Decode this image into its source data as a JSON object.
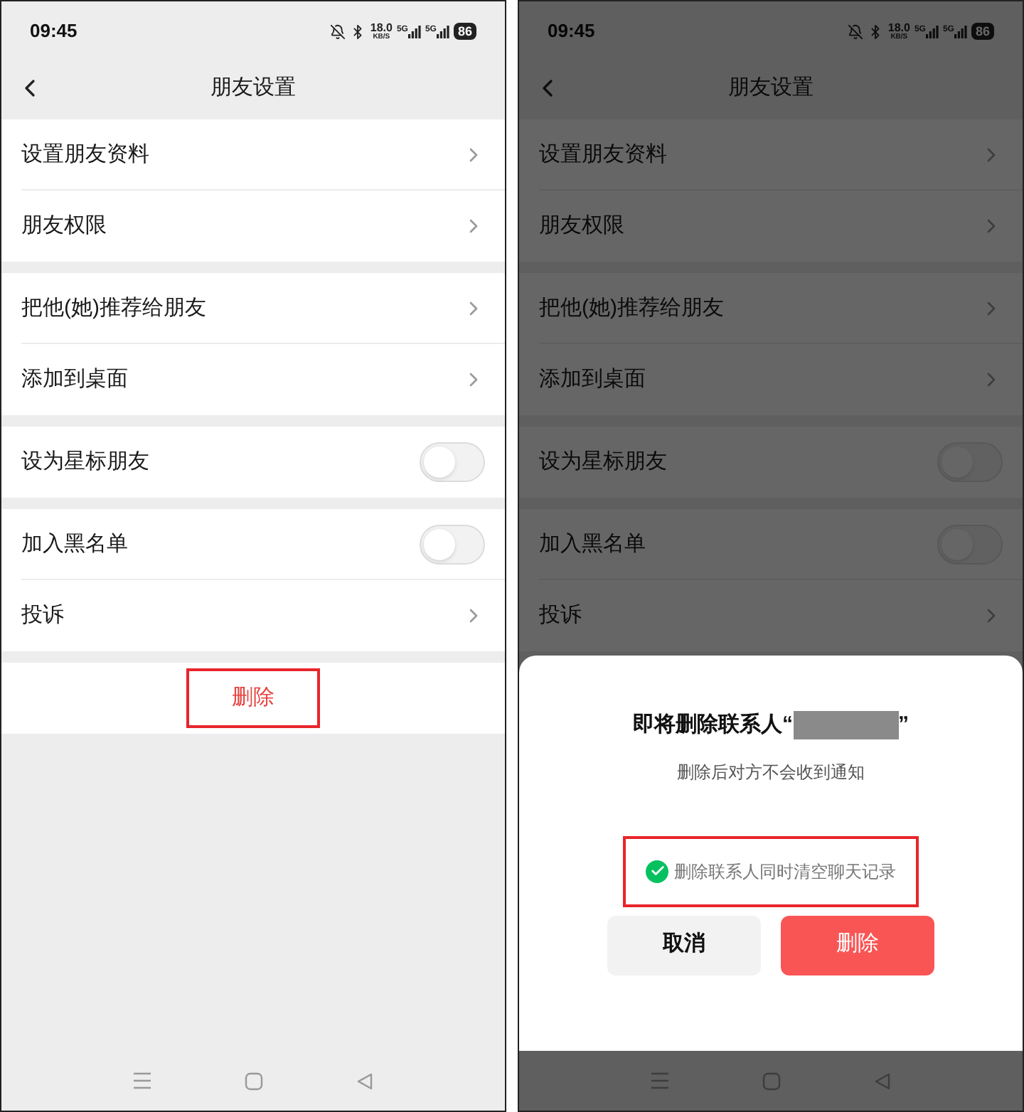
{
  "screens": [
    {
      "status_bar": {
        "time": "09:45",
        "speed": "18.0",
        "speed_unit": "KB/S",
        "networks": [
          "5G",
          "5G"
        ],
        "battery": "86"
      },
      "header": {
        "title": "朋友设置"
      },
      "dimmed": false,
      "groups": [
        {
          "rows": [
            {
              "kind": "link",
              "label": "设置朋友资料"
            },
            {
              "kind": "link",
              "label": "朋友权限"
            }
          ]
        },
        {
          "rows": [
            {
              "kind": "link",
              "label": "把他(她)推荐给朋友"
            },
            {
              "kind": "link",
              "label": "添加到桌面"
            }
          ]
        },
        {
          "rows": [
            {
              "kind": "toggle",
              "label": "设为星标朋友",
              "on": false
            }
          ]
        },
        {
          "rows": [
            {
              "kind": "toggle",
              "label": "加入黑名单",
              "on": false
            },
            {
              "kind": "link",
              "label": "投诉"
            }
          ]
        }
      ],
      "delete_button": {
        "label": "删除",
        "highlighted": true
      }
    },
    {
      "status_bar": {
        "time": "09:45",
        "speed": "18.0",
        "speed_unit": "KB/S",
        "networks": [
          "5G",
          "5G"
        ],
        "battery": "86"
      },
      "header": {
        "title": "朋友设置"
      },
      "dimmed": true,
      "groups": [
        {
          "rows": [
            {
              "kind": "link",
              "label": "设置朋友资料"
            },
            {
              "kind": "link",
              "label": "朋友权限"
            }
          ]
        },
        {
          "rows": [
            {
              "kind": "link",
              "label": "把他(她)推荐给朋友"
            },
            {
              "kind": "link",
              "label": "添加到桌面"
            }
          ]
        },
        {
          "rows": [
            {
              "kind": "toggle",
              "label": "设为星标朋友",
              "on": false
            }
          ]
        },
        {
          "rows": [
            {
              "kind": "toggle",
              "label": "加入黑名单",
              "on": false
            },
            {
              "kind": "link",
              "label": "投诉"
            }
          ]
        }
      ],
      "dialog": {
        "title_prefix": "即将删除联系人“",
        "title_suffix": "”",
        "subtitle": "删除后对方不会收到通知",
        "option": {
          "label": "删除联系人同时清空聊天记录",
          "checked": true,
          "highlighted": true
        },
        "buttons": [
          {
            "kind": "cancel",
            "label": "取消"
          },
          {
            "kind": "danger",
            "label": "删除"
          }
        ]
      }
    }
  ]
}
